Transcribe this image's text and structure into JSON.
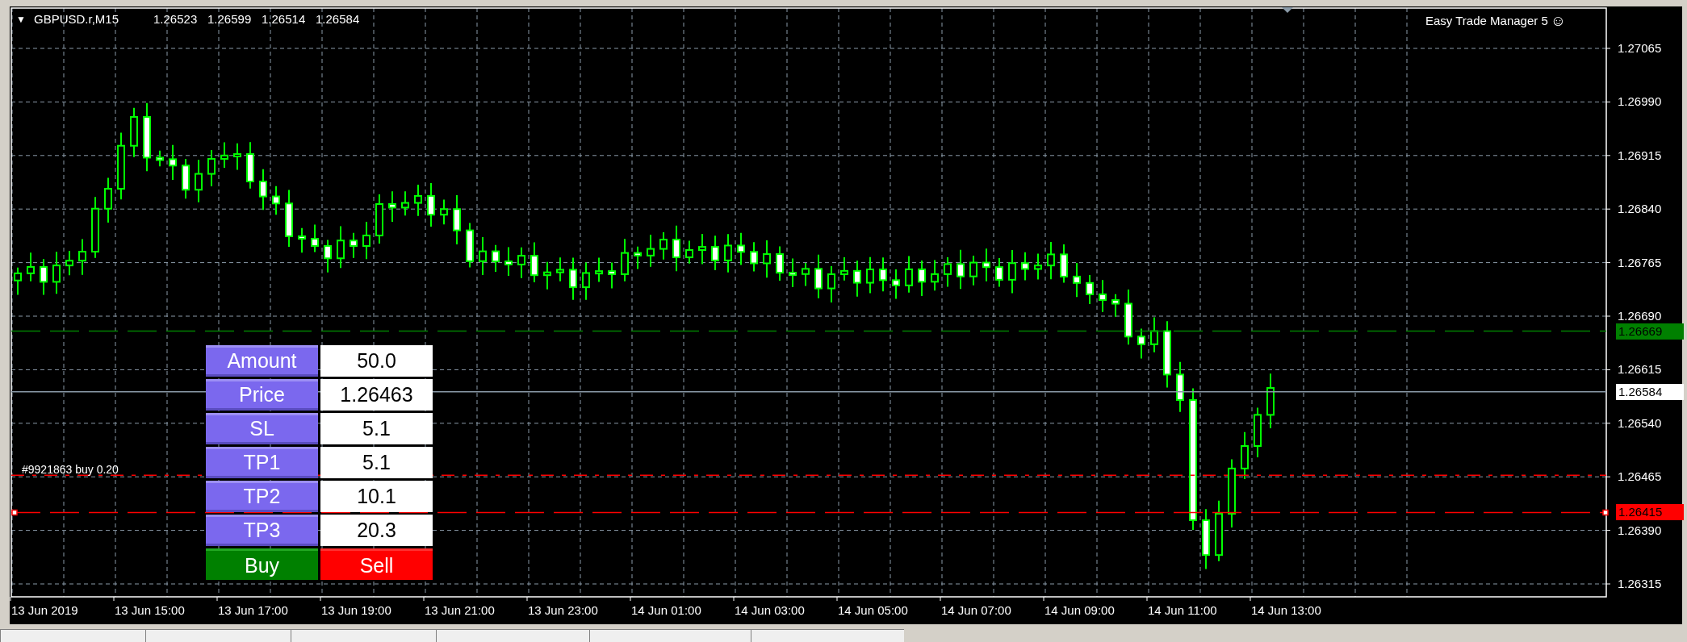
{
  "chart_header": {
    "menu_glyph": "▼",
    "symbol": "GBPUSD.r,M15",
    "quotes": [
      "1.26523",
      "1.26599",
      "1.26514",
      "1.26584"
    ]
  },
  "expert_title": {
    "text": "Easy Trade Manager 5",
    "glyph": "☺"
  },
  "order_label": "#9921863 buy 0.20",
  "price_axis": [
    "1.27065",
    "1.26990",
    "1.26915",
    "1.26840",
    "1.26765",
    "1.26690",
    "1.26615",
    "1.26540",
    "1.26465",
    "1.26390",
    "1.26315"
  ],
  "price_tags": [
    {
      "text": "1.26669",
      "color": "#008000",
      "kind": "dashed"
    },
    {
      "text": "1.26584",
      "color": "#ffffff",
      "kind": "solid"
    },
    {
      "text": "1.26415",
      "color": "#ff0000",
      "kind": "dashed"
    }
  ],
  "time_axis": [
    "13 Jun 2019",
    "13 Jun 15:00",
    "13 Jun 17:00",
    "13 Jun 19:00",
    "13 Jun 21:00",
    "13 Jun 23:00",
    "14 Jun 01:00",
    "14 Jun 03:00",
    "14 Jun 05:00",
    "14 Jun 07:00",
    "14 Jun 09:00",
    "14 Jun 11:00",
    "14 Jun 13:00"
  ],
  "panel": {
    "rows": [
      {
        "label": "Amount",
        "value": "50.0"
      },
      {
        "label": "Price",
        "value": "1.26463"
      },
      {
        "label": "SL",
        "value": "5.1"
      },
      {
        "label": "TP1",
        "value": "5.1"
      },
      {
        "label": "TP2",
        "value": "10.1"
      },
      {
        "label": "TP3",
        "value": "20.3"
      }
    ],
    "buttons": [
      {
        "label": "Buy",
        "kind": "buy"
      },
      {
        "label": "Sell",
        "kind": "sell"
      }
    ]
  }
}
